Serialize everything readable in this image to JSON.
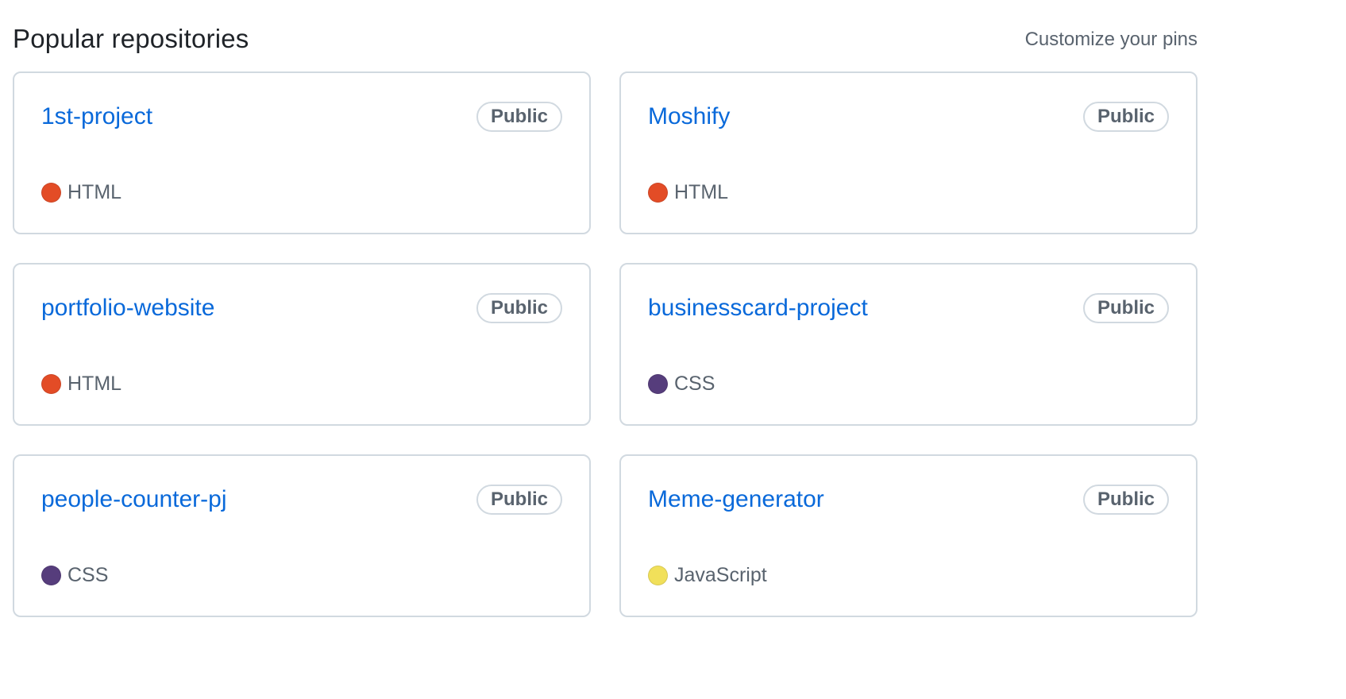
{
  "header": {
    "title": "Popular repositories",
    "customize_label": "Customize your pins"
  },
  "repos": [
    {
      "name": "1st-project",
      "visibility": "Public",
      "language": "HTML",
      "language_color": "#e34c26"
    },
    {
      "name": "Moshify",
      "visibility": "Public",
      "language": "HTML",
      "language_color": "#e34c26"
    },
    {
      "name": "portfolio-website",
      "visibility": "Public",
      "language": "HTML",
      "language_color": "#e34c26"
    },
    {
      "name": "businesscard-project",
      "visibility": "Public",
      "language": "CSS",
      "language_color": "#563d7c"
    },
    {
      "name": "people-counter-pj",
      "visibility": "Public",
      "language": "CSS",
      "language_color": "#563d7c"
    },
    {
      "name": "Meme-generator",
      "visibility": "Public",
      "language": "JavaScript",
      "language_color": "#f1e05a"
    }
  ],
  "colors": {
    "link": "#0969da",
    "muted": "#59636e",
    "border": "#d1d9e0"
  }
}
